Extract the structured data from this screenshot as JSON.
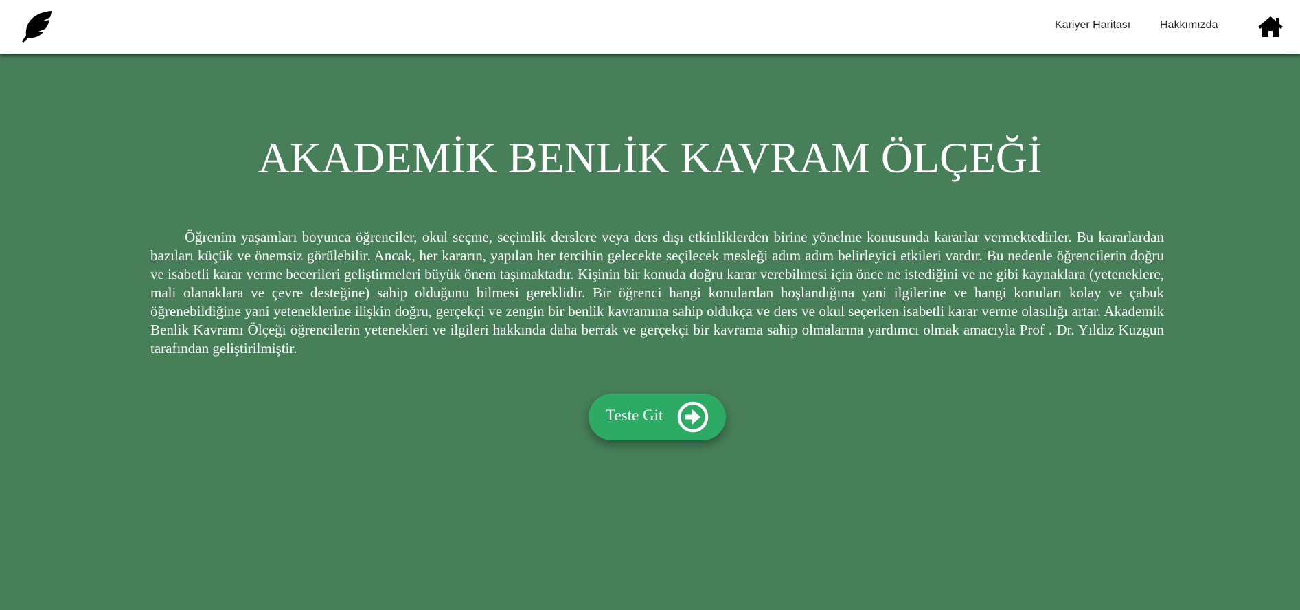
{
  "header": {
    "logo_icon": "feather-icon",
    "nav": [
      {
        "label": "Kariyer Haritası"
      },
      {
        "label": "Hakkımızda"
      }
    ],
    "home_icon": "home-icon"
  },
  "main": {
    "title": "AKADEMİK BENLİK KAVRAM ÖLÇEĞİ",
    "description": "Öğrenim yaşamları boyunca öğrenciler, okul seçme, seçimlik derslere veya ders dışı etkinliklerden birine yönelme konusunda kararlar vermektedirler. Bu kararlardan bazıları küçük ve önemsiz görülebilir. Ancak, her kararın, yapılan her tercihin gelecekte seçilecek mesleği adım adım belirleyici etkileri vardır. Bu nedenle öğrencilerin doğru ve isabetli karar verme becerileri geliştirmeleri büyük önem taşımaktadır. Kişinin bir konuda doğru karar verebilmesi için önce ne istediğini ve ne gibi kaynaklara (yeteneklere, mali olanaklara ve çevre desteğine) sahip olduğunu bilmesi gereklidir. Bir öğrenci hangi konulardan hoşlandığına yani ilgilerine ve hangi konuları kolay ve çabuk öğrenebildiğine yani yeteneklerine ilişkin doğru, gerçekçi ve zengin bir benlik kavramına sahip oldukça ve ders ve okul seçerken isabetli karar verme olasılığı artar. Akademik Benlik Kavramı Ölçeği öğrencilerin yetenekleri ve ilgileri hakkında daha berrak ve gerçekçi bir kavrama sahip olmalarına yardımcı olmak amacıyla Prof . Dr. Yıldız Kuzgun tarafından geliştirilmiştir.",
    "button": {
      "label": "Teste Git",
      "icon": "arrow-right-circle-icon"
    }
  },
  "colors": {
    "background": "#467f58",
    "button": "#2daa63",
    "header": "#ffffff"
  }
}
